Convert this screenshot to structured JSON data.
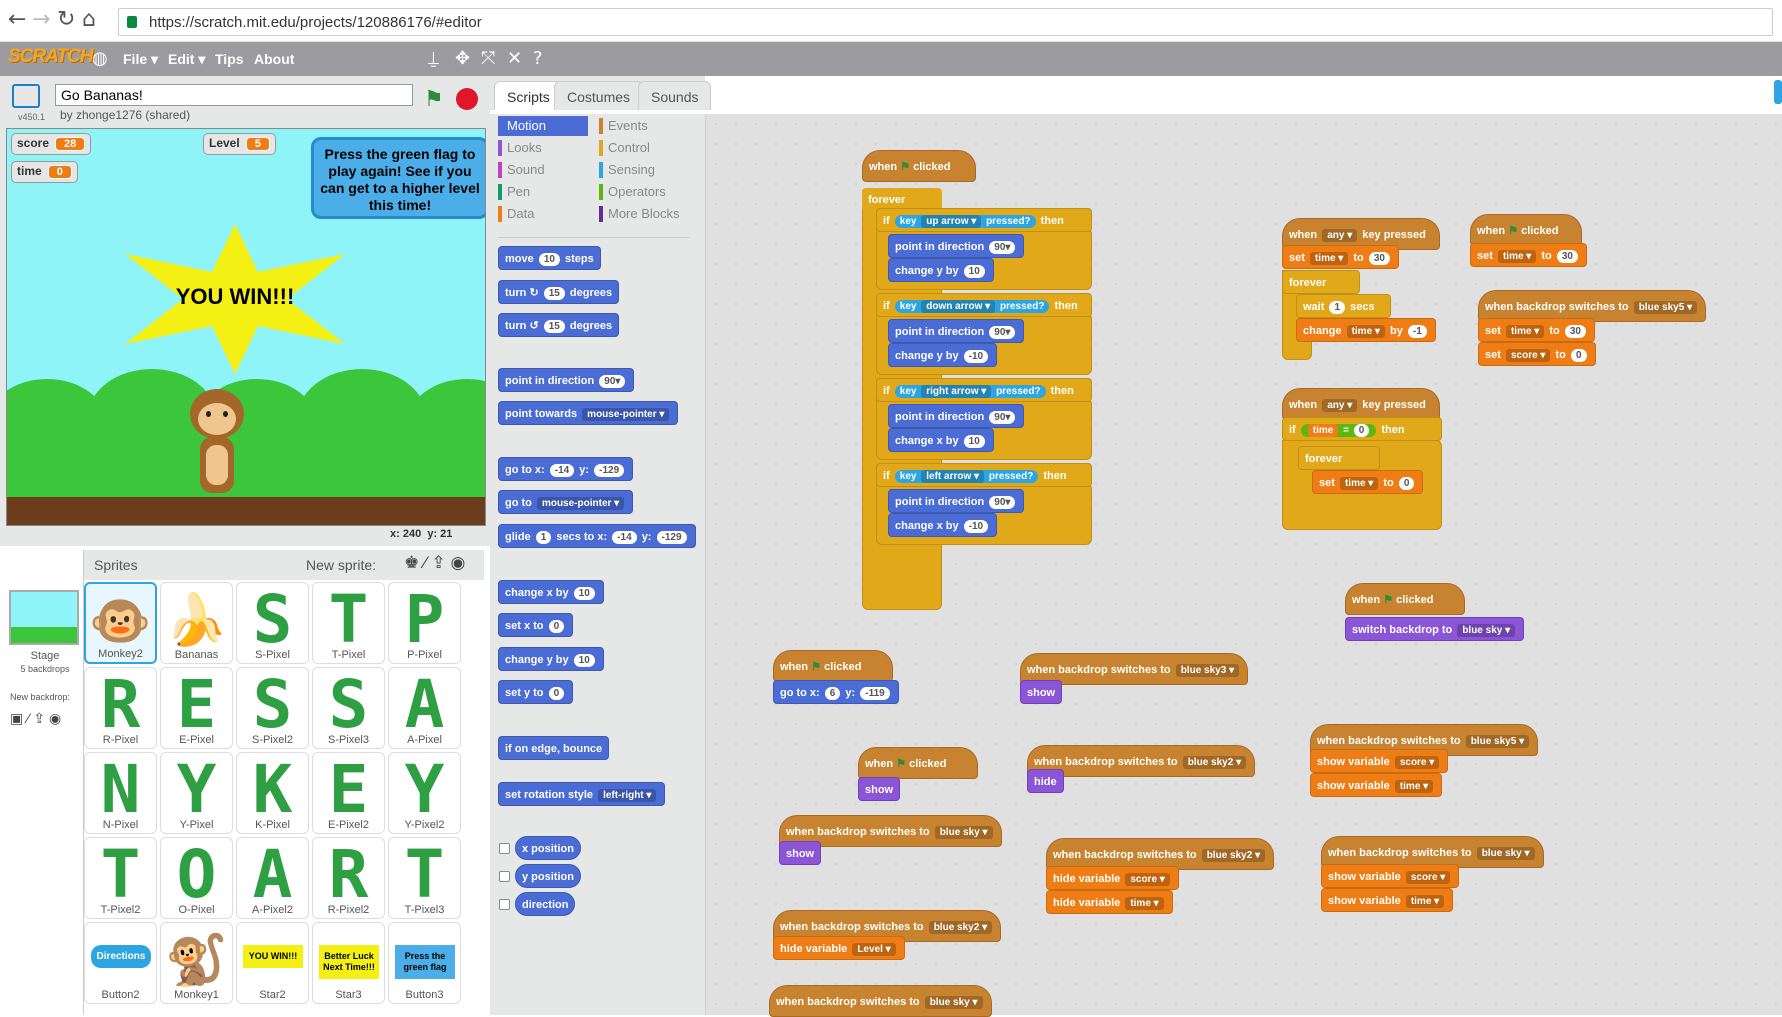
{
  "browser": {
    "url": "https://scratch.mit.edu/projects/120886176/#editor"
  },
  "menu": {
    "logo": "SCRATCH",
    "file": "File ▾",
    "edit": "Edit ▾",
    "tips": "Tips",
    "about": "About"
  },
  "project": {
    "title": "Go Bananas!",
    "byline": "by zhonge1276 (shared)",
    "version": "v450.1"
  },
  "stage": {
    "score_label": "score",
    "score_val": "28",
    "level_label": "Level",
    "level_val": "5",
    "time_label": "time",
    "time_val": "0",
    "bubble": "Press the green flag to play again! See if you can get to a higher level this time!",
    "star_text": "YOU WIN!!!",
    "x_label": "x:",
    "x_val": "240",
    "y_label": "y:",
    "y_val": "21"
  },
  "sprites": {
    "header": "Sprites",
    "new_sprite": "New sprite:",
    "stage_label": "Stage",
    "stage_sub": "5 backdrops",
    "new_backdrop": "New backdrop:",
    "items": [
      {
        "name": "Monkey2",
        "glyph": "🐵"
      },
      {
        "name": "Bananas",
        "glyph": "🍌"
      },
      {
        "name": "S-Pixel",
        "glyph": "S"
      },
      {
        "name": "T-Pixel",
        "glyph": "T"
      },
      {
        "name": "P-Pixel",
        "glyph": "P"
      },
      {
        "name": "R-Pixel",
        "glyph": "R"
      },
      {
        "name": "E-Pixel",
        "glyph": "E"
      },
      {
        "name": "S-Pixel2",
        "glyph": "S"
      },
      {
        "name": "S-Pixel3",
        "glyph": "S"
      },
      {
        "name": "A-Pixel",
        "glyph": "A"
      },
      {
        "name": "N-Pixel",
        "glyph": "N"
      },
      {
        "name": "Y-Pixel",
        "glyph": "Y"
      },
      {
        "name": "K-Pixel",
        "glyph": "K"
      },
      {
        "name": "E-Pixel2",
        "glyph": "E"
      },
      {
        "name": "Y-Pixel2",
        "glyph": "Y"
      },
      {
        "name": "T-Pixel2",
        "glyph": "T"
      },
      {
        "name": "O-Pixel",
        "glyph": "O"
      },
      {
        "name": "A-Pixel2",
        "glyph": "A"
      },
      {
        "name": "R-Pixel2",
        "glyph": "R"
      },
      {
        "name": "T-Pixel3",
        "glyph": "T"
      },
      {
        "name": "Button2",
        "glyph": "Directions"
      },
      {
        "name": "Monkey1",
        "glyph": "🐒"
      },
      {
        "name": "Star2",
        "glyph": "YOU WIN!!!"
      },
      {
        "name": "Star3",
        "glyph": "Better Luck Next Time!!!"
      },
      {
        "name": "Button3",
        "glyph": "Press the green flag"
      }
    ]
  },
  "tabs": {
    "scripts": "Scripts",
    "costumes": "Costumes",
    "sounds": "Sounds"
  },
  "categories": [
    {
      "name": "Motion",
      "color": "#4a6cd4"
    },
    {
      "name": "Events",
      "color": "#c88330"
    },
    {
      "name": "Looks",
      "color": "#8a55d7"
    },
    {
      "name": "Control",
      "color": "#e1a91a"
    },
    {
      "name": "Sound",
      "color": "#bb42c3"
    },
    {
      "name": "Sensing",
      "color": "#2ca5e2"
    },
    {
      "name": "Pen",
      "color": "#0e9a6c"
    },
    {
      "name": "Operators",
      "color": "#5cb712"
    },
    {
      "name": "Data",
      "color": "#ee7d16"
    },
    {
      "name": "More Blocks",
      "color": "#632d99"
    }
  ],
  "palette": {
    "move": "move",
    "steps": "steps",
    "move_n": "10",
    "turn": "turn",
    "degrees": "degrees",
    "turn_n": "15",
    "point_dir": "point in direction",
    "dir_n": "90▾",
    "point_towards": "point towards",
    "mouse": "mouse-pointer ▾",
    "goto": "go to x:",
    "y": "y:",
    "gx": "-14",
    "gy": "-129",
    "goto2": "go to",
    "glide": "glide",
    "secs_to_x": "secs to x:",
    "glide_n": "1",
    "change_x": "change x by",
    "set_x": "set x to",
    "change_y": "change y by",
    "set_y": "set y to",
    "ten": "10",
    "zero": "0",
    "bounce": "if on edge, bounce",
    "rot": "set rotation style",
    "rot_dd": "left-right ▾",
    "xpos": "x position",
    "ypos": "y position",
    "direction": "direction"
  },
  "scripts": {
    "when": "when",
    "clicked": "clicked",
    "forever": "forever",
    "if": "if",
    "then": "then",
    "key": "key",
    "pressed": "pressed?",
    "up": "up arrow ▾",
    "down": "down arrow ▾",
    "right": "right arrow ▾",
    "left": "left arrow ▾",
    "point_dir": "point in direction",
    "d90": "90▾",
    "change_y": "change y by",
    "change_x": "change x by",
    "ten": "10",
    "neg10": "-10",
    "when_any": "any ▾",
    "key_pressed": "key pressed",
    "set": "set",
    "time": "time ▾",
    "score": "score ▾",
    "to": "to",
    "thirty": "30",
    "zero": "0",
    "wait": "wait",
    "secs": "secs",
    "one": "1",
    "change": "change",
    "by": "by",
    "neg1": "-1",
    "time_r": "time",
    "eq": "=",
    "when_backdrop": "when backdrop switches to",
    "sky5": "blue sky5 ▾",
    "sky3": "blue sky3 ▾",
    "sky2": "blue sky2 ▾",
    "sky": "blue sky ▾",
    "switch_backdrop": "switch backdrop to",
    "show": "show",
    "goto": "go to x:",
    "gx": "6",
    "gy": "-119",
    "y": "y:",
    "show_var": "show variable",
    "hide_var": "hide variable",
    "level": "Level ▾"
  }
}
